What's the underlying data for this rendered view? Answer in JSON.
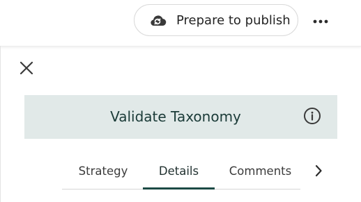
{
  "header": {
    "publish_label": "Prepare to publish",
    "publish_icon": "cloud-sync-icon",
    "more_icon": "more-horizontal-icon"
  },
  "panel": {
    "close_icon": "close-icon",
    "title": "Validate Taxonomy",
    "info_icon": "info-icon",
    "tabs": [
      {
        "label": "Strategy",
        "active": false
      },
      {
        "label": "Details",
        "active": true
      },
      {
        "label": "Comments",
        "active": false
      }
    ],
    "next_icon": "chevron-right-icon"
  },
  "colors": {
    "banner_bg": "#e1e9e8",
    "title_text": "#1b3b38",
    "active_tab_underline": "#1c4a45"
  }
}
